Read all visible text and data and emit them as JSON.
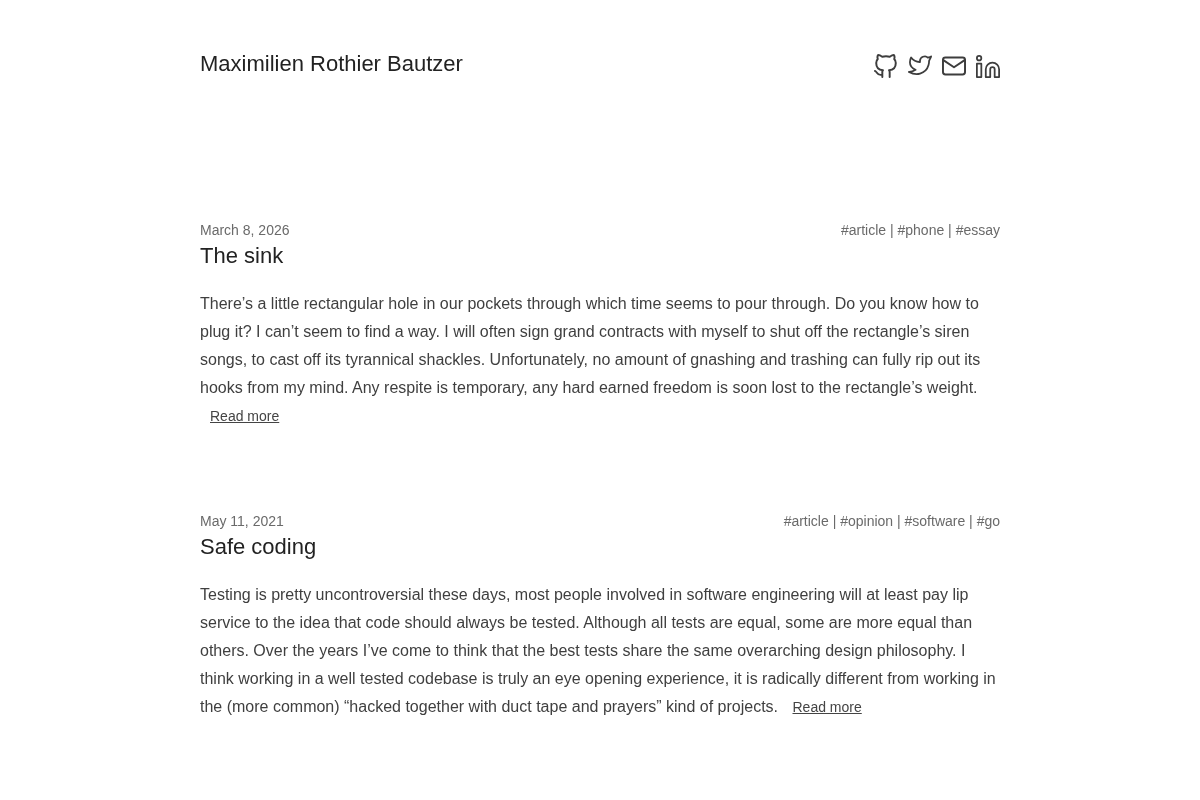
{
  "header": {
    "site_title": "Maximilien Rothier Bautzer"
  },
  "posts": [
    {
      "date": "March 8, 2026",
      "tags": "#article | #phone | #essay",
      "title": "The sink",
      "excerpt": "There’s a little rectangular hole in our pockets through which time seems to pour through. Do you know how to plug it? I can’t seem to find a way. I will often sign grand contracts with myself to shut off the rectangle’s siren songs, to cast off its tyrannical shackles. Unfortunately, no amount of gnashing and trashing can fully rip out its hooks from my mind. Any respite is temporary, any hard earned freedom is soon lost to the rectangle’s weight.",
      "read_more": "Read more"
    },
    {
      "date": "May 11, 2021",
      "tags": "#article | #opinion | #software | #go",
      "title": "Safe coding",
      "excerpt": "Testing is pretty uncontroversial these days, most people involved in software engineering will at least pay lip service to the idea that code should always be tested. Although all tests are equal, some are more equal than others. Over the years I’ve come to think that the best tests share the same overarching design philosophy. I think working in a well tested codebase is truly an eye opening experience, it is radically different from working in the (more common) “hacked together with duct tape and prayers” kind of projects.",
      "read_more": "Read more"
    }
  ]
}
